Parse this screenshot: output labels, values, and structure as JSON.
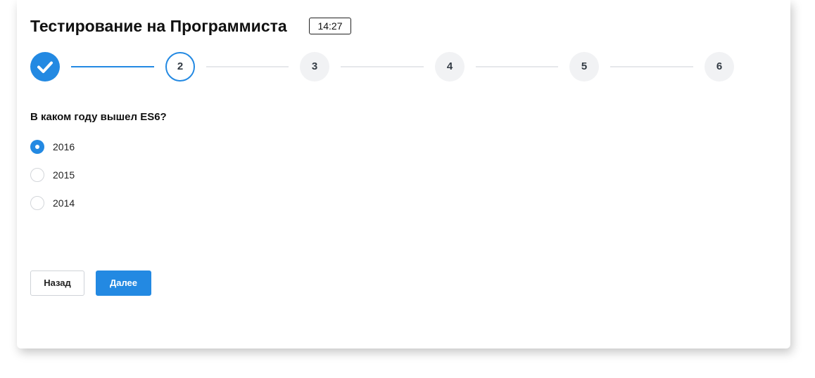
{
  "header": {
    "title": "Тестирование на Программиста",
    "timer": "14:27"
  },
  "stepper": {
    "steps": [
      {
        "label": "",
        "state": "done",
        "icon": "check-icon"
      },
      {
        "label": "2",
        "state": "current"
      },
      {
        "label": "3",
        "state": "pending"
      },
      {
        "label": "4",
        "state": "pending"
      },
      {
        "label": "5",
        "state": "pending"
      },
      {
        "label": "6",
        "state": "pending"
      }
    ]
  },
  "question": {
    "text": "В каком году вышел ES6?",
    "options": [
      {
        "label": "2016",
        "selected": true
      },
      {
        "label": "2015",
        "selected": false
      },
      {
        "label": "2014",
        "selected": false
      }
    ]
  },
  "actions": {
    "back_label": "Назад",
    "next_label": "Далее"
  },
  "colors": {
    "accent": "#2389e2",
    "pending_step_bg": "#f1f2f4",
    "connector": "#e6e8eb"
  }
}
